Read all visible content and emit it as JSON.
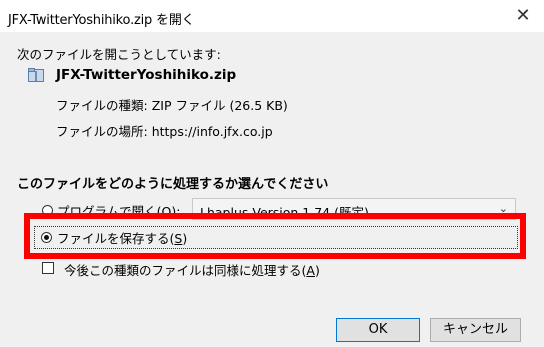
{
  "window": {
    "title": "JFX-TwitterYoshihiko.zip を開く",
    "close_glyph": "✕"
  },
  "dialog": {
    "prompt": "次のファイルを開こうとしています:",
    "file_name": "JFX-TwitterYoshihiko.zip",
    "file_type_label": "ファイルの種類:",
    "file_type_value": "ZIP ファイル (26.5 KB)",
    "file_location_label": "ファイルの場所:",
    "file_location_value": "https://info.jfx.co.jp",
    "question": "このファイルをどのように処理するか選んでください",
    "open_with_prefix": "プログラムで開く(",
    "open_with_key": "O",
    "open_with_suffix": "):",
    "open_with_selected": "Lhaplus Version 1.74 (既定)",
    "open_with_checked": false,
    "save_prefix": "ファイルを保存する(",
    "save_key": "S",
    "save_suffix": ")",
    "save_checked": true,
    "remember_prefix": "今後この種類のファイルは同様に処理する(",
    "remember_key": "A",
    "remember_suffix": ")",
    "remember_checked": false
  },
  "buttons": {
    "ok": "OK",
    "cancel": "キャンセル"
  },
  "colors": {
    "highlight": "#ff0000",
    "dialog_bg": "#f0f0f0",
    "titlebar_bg": "#ffffff"
  },
  "icons": {
    "file": "zip-file-icon",
    "close": "close-icon",
    "dropdown": "chevron-down-icon"
  }
}
